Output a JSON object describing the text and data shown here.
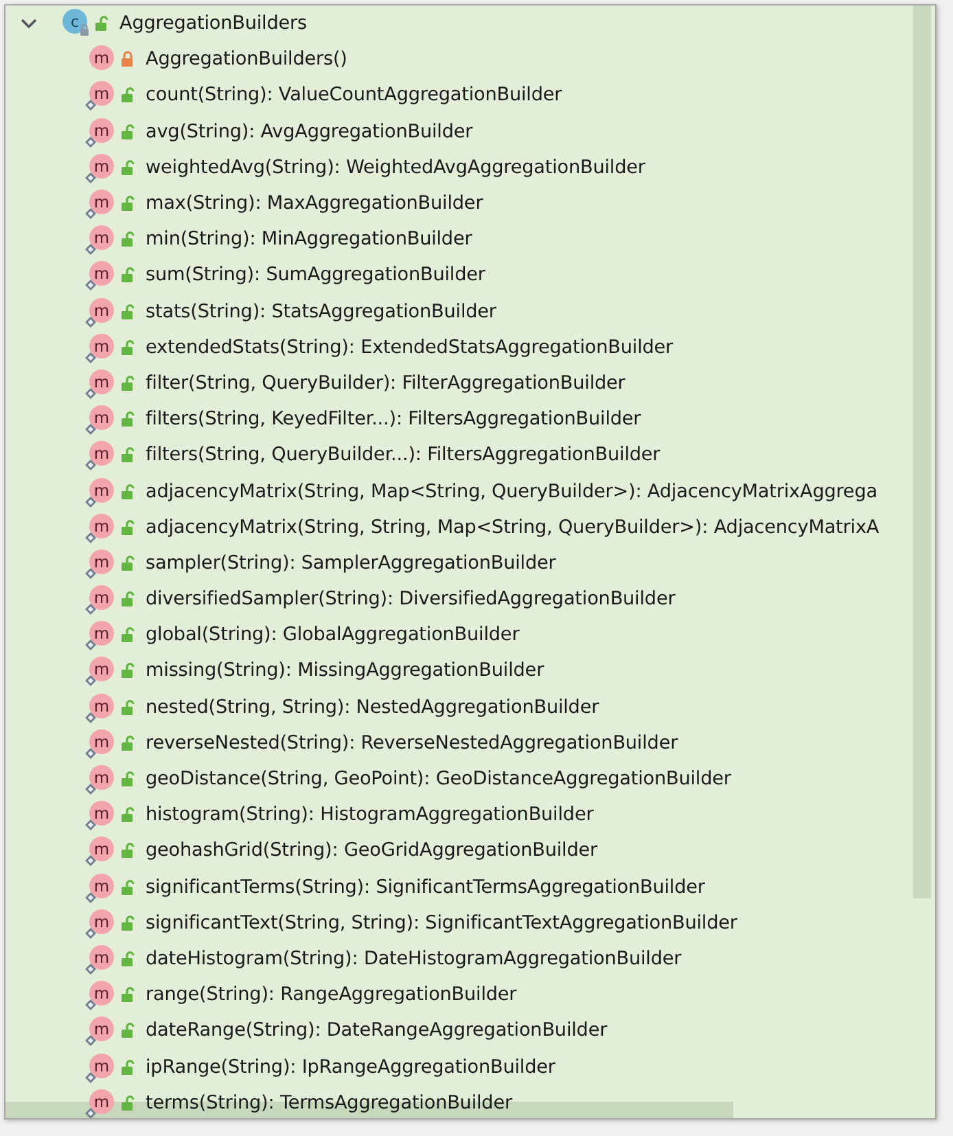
{
  "class": {
    "icon": "c",
    "name": "AggregationBuilders",
    "expanded": true,
    "private": false
  },
  "members": [
    {
      "icon": "m",
      "text": "AggregationBuilders()",
      "private": true,
      "static": false
    },
    {
      "icon": "m",
      "text": "count(String): ValueCountAggregationBuilder",
      "private": false,
      "static": true
    },
    {
      "icon": "m",
      "text": "avg(String): AvgAggregationBuilder",
      "private": false,
      "static": true
    },
    {
      "icon": "m",
      "text": "weightedAvg(String): WeightedAvgAggregationBuilder",
      "private": false,
      "static": true
    },
    {
      "icon": "m",
      "text": "max(String): MaxAggregationBuilder",
      "private": false,
      "static": true
    },
    {
      "icon": "m",
      "text": "min(String): MinAggregationBuilder",
      "private": false,
      "static": true
    },
    {
      "icon": "m",
      "text": "sum(String): SumAggregationBuilder",
      "private": false,
      "static": true
    },
    {
      "icon": "m",
      "text": "stats(String): StatsAggregationBuilder",
      "private": false,
      "static": true
    },
    {
      "icon": "m",
      "text": "extendedStats(String): ExtendedStatsAggregationBuilder",
      "private": false,
      "static": true
    },
    {
      "icon": "m",
      "text": "filter(String, QueryBuilder): FilterAggregationBuilder",
      "private": false,
      "static": true
    },
    {
      "icon": "m",
      "text": "filters(String, KeyedFilter...): FiltersAggregationBuilder",
      "private": false,
      "static": true
    },
    {
      "icon": "m",
      "text": "filters(String, QueryBuilder...): FiltersAggregationBuilder",
      "private": false,
      "static": true
    },
    {
      "icon": "m",
      "text": "adjacencyMatrix(String, Map<String, QueryBuilder>): AdjacencyMatrixAggrega",
      "private": false,
      "static": true
    },
    {
      "icon": "m",
      "text": "adjacencyMatrix(String, String, Map<String, QueryBuilder>): AdjacencyMatrixA",
      "private": false,
      "static": true
    },
    {
      "icon": "m",
      "text": "sampler(String): SamplerAggregationBuilder",
      "private": false,
      "static": true
    },
    {
      "icon": "m",
      "text": "diversifiedSampler(String): DiversifiedAggregationBuilder",
      "private": false,
      "static": true
    },
    {
      "icon": "m",
      "text": "global(String): GlobalAggregationBuilder",
      "private": false,
      "static": true
    },
    {
      "icon": "m",
      "text": "missing(String): MissingAggregationBuilder",
      "private": false,
      "static": true
    },
    {
      "icon": "m",
      "text": "nested(String, String): NestedAggregationBuilder",
      "private": false,
      "static": true
    },
    {
      "icon": "m",
      "text": "reverseNested(String): ReverseNestedAggregationBuilder",
      "private": false,
      "static": true
    },
    {
      "icon": "m",
      "text": "geoDistance(String, GeoPoint): GeoDistanceAggregationBuilder",
      "private": false,
      "static": true
    },
    {
      "icon": "m",
      "text": "histogram(String): HistogramAggregationBuilder",
      "private": false,
      "static": true
    },
    {
      "icon": "m",
      "text": "geohashGrid(String): GeoGridAggregationBuilder",
      "private": false,
      "static": true
    },
    {
      "icon": "m",
      "text": "significantTerms(String): SignificantTermsAggregationBuilder",
      "private": false,
      "static": true
    },
    {
      "icon": "m",
      "text": "significantText(String, String): SignificantTextAggregationBuilder",
      "private": false,
      "static": true
    },
    {
      "icon": "m",
      "text": "dateHistogram(String): DateHistogramAggregationBuilder",
      "private": false,
      "static": true
    },
    {
      "icon": "m",
      "text": "range(String): RangeAggregationBuilder",
      "private": false,
      "static": true
    },
    {
      "icon": "m",
      "text": "dateRange(String): DateRangeAggregationBuilder",
      "private": false,
      "static": true
    },
    {
      "icon": "m",
      "text": "ipRange(String): IpRangeAggregationBuilder",
      "private": false,
      "static": true
    },
    {
      "icon": "m",
      "text": "terms(String): TermsAggregationBuilder",
      "private": false,
      "static": true
    }
  ]
}
